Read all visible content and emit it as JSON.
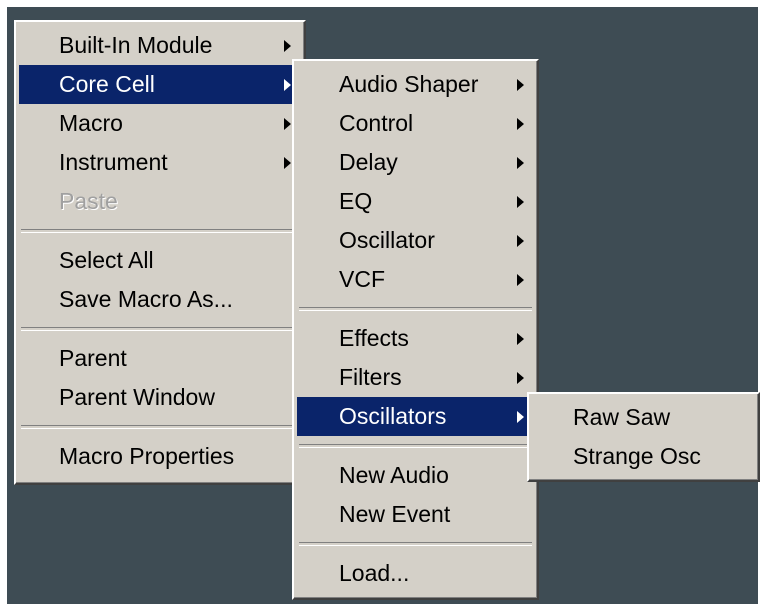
{
  "main_menu": {
    "items": [
      {
        "label": "Built-In Module",
        "submenu": true
      },
      {
        "label": "Core Cell",
        "submenu": true,
        "selected": true
      },
      {
        "label": "Macro",
        "submenu": true
      },
      {
        "label": "Instrument",
        "submenu": true
      },
      {
        "label": "Paste",
        "disabled": true
      },
      {
        "label": "Select All"
      },
      {
        "label": "Save Macro As..."
      },
      {
        "label": "Parent"
      },
      {
        "label": "Parent Window"
      },
      {
        "label": "Macro Properties"
      }
    ]
  },
  "core_cell_menu": {
    "items": [
      {
        "label": "Audio Shaper",
        "submenu": true
      },
      {
        "label": "Control",
        "submenu": true
      },
      {
        "label": "Delay",
        "submenu": true
      },
      {
        "label": "EQ",
        "submenu": true
      },
      {
        "label": "Oscillator",
        "submenu": true
      },
      {
        "label": "VCF",
        "submenu": true
      },
      {
        "label": "Effects",
        "submenu": true
      },
      {
        "label": "Filters",
        "submenu": true
      },
      {
        "label": "Oscillators",
        "submenu": true,
        "selected": true
      },
      {
        "label": "New Audio"
      },
      {
        "label": "New Event"
      },
      {
        "label": "Load..."
      }
    ]
  },
  "oscillators_menu": {
    "items": [
      {
        "label": "Raw Saw"
      },
      {
        "label": "Strange Osc"
      }
    ]
  },
  "colors": {
    "menu_bg": "#d4d0c8",
    "selection": "#0a246a",
    "desktop": "#3e4c54",
    "disabled_text": "#a0a0a0"
  },
  "icons": [
    "submenu-arrow-icon"
  ]
}
